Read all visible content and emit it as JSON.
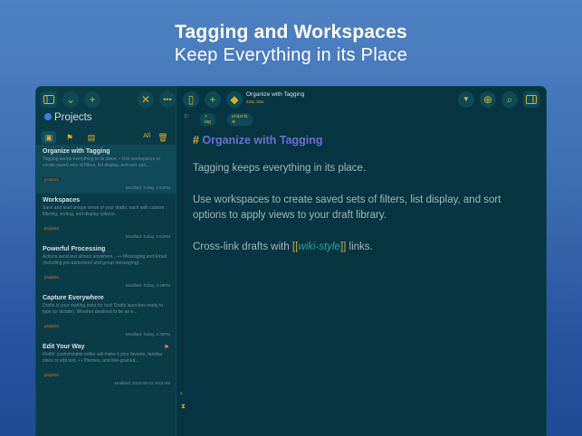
{
  "hero": {
    "title": "Tagging and Workspaces",
    "subtitle": "Keep Everything in its Place"
  },
  "sidebar": {
    "workspace_title": "Projects",
    "filter_all": "All",
    "toolbar_icons": [
      "sidebar-toggle-icon",
      "chevron-down-icon",
      "plus-icon",
      "close-icon",
      "more-icon"
    ],
    "items": [
      {
        "title": "Organize with Tagging",
        "preview": "Tagging keeps everything in its place. • Use workspaces to create saved sets of filters, list display, and sort opti...",
        "tag": "projects",
        "modified": "Modified: Today, 2:51PM"
      },
      {
        "title": "Workspaces",
        "preview": "Save and load unique views of your drafts, each with custom filtering, sorting, and display options.",
        "tag": "projects",
        "modified": "Modified: Today, 2:51PM"
      },
      {
        "title": "Powerful Processing",
        "preview": "Actions send text almost anywhere... • • Messaging and Email (including pre-addressed and group messaging)...",
        "tag": "projects",
        "modified": "Modified: Today, 2:49PM"
      },
      {
        "title": "Capture Everywhere",
        "preview": "Drafts is your starting point for text! Drafts launches ready to type (or dictate). Whether destined to be an e...",
        "tag": "projects",
        "modified": "Modified: Today, 2:39PM"
      },
      {
        "title": "Edit Your Way",
        "preview": "Drafts' customizable editor will make it your favorite, familiar place to edit text. • • Themes, and fine-grained...",
        "tag": "projects",
        "modified": "Modified: 2023-08-13, 9:53 AM"
      }
    ]
  },
  "editor": {
    "doc_title": "Organize with Tagging",
    "doc_stats": "233c 36w",
    "add_tag": "+ tag",
    "tag_chip": "projects",
    "heading_hash": "#",
    "heading": "Organize with Tagging",
    "para1": "Tagging keeps everything in its place.",
    "para2": "Use workspaces to create saved sets of filters, list display, and sort options to apply views to your draft library.",
    "para3_pre": "Cross-link drafts with ",
    "link_open": "[[",
    "link_text": "wiki-style",
    "link_close": "]]",
    "para3_post": " links."
  },
  "colors": {
    "accent": "#d8ad2a",
    "heading": "#6d6dd6",
    "background": "#063541"
  }
}
